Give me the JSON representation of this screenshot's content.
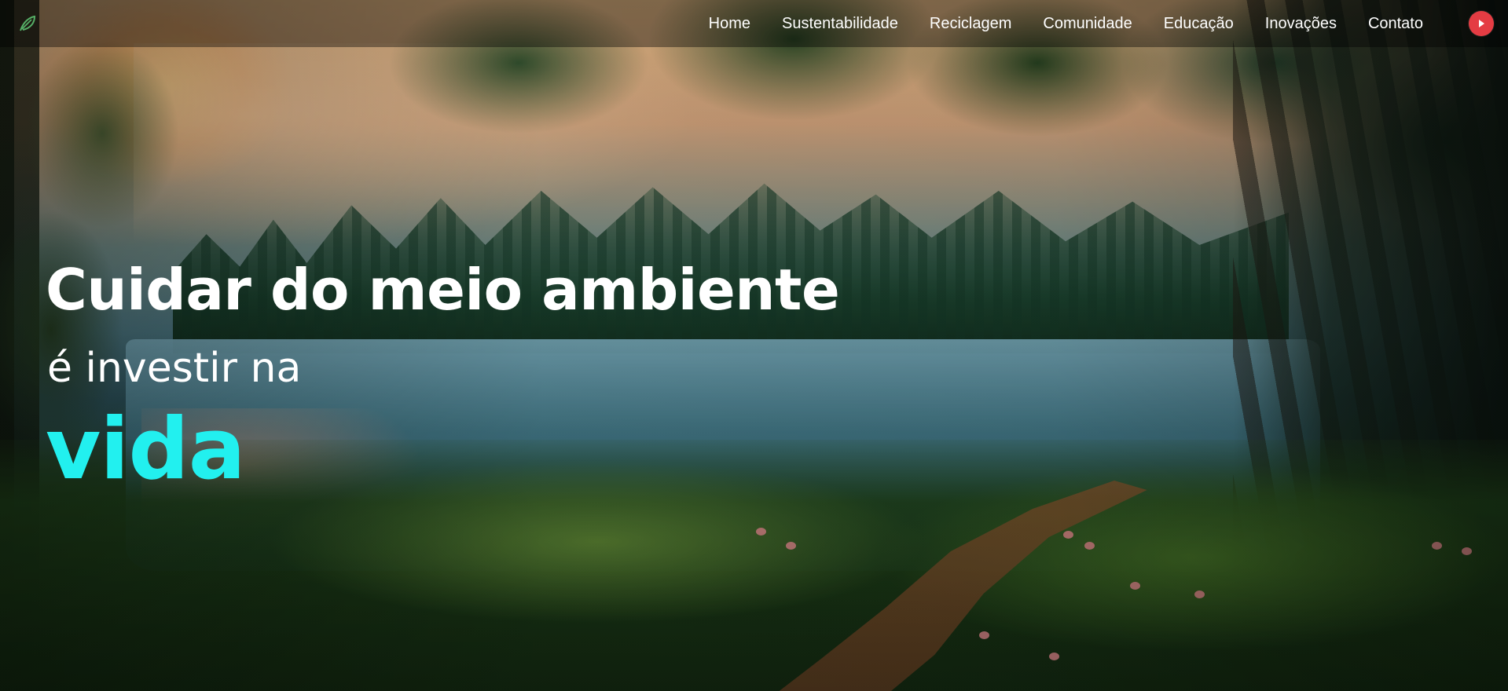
{
  "navbar": {
    "logo_icon": "leaf-icon",
    "links": [
      "Home",
      "Sustentabilidade",
      "Reciclagem",
      "Comunidade",
      "Educação",
      "Inovações",
      "Contato"
    ],
    "play_icon": "play-icon"
  },
  "hero": {
    "line_1": "Cuidar do meio ambiente",
    "line_2": "é investir na",
    "line_3": "vida"
  },
  "colors": {
    "accent_cyan": "#22f0ef",
    "play_red": "#e43c43",
    "nav_overlay": "rgba(0,0,0,0.38)",
    "text_white": "#ffffff"
  }
}
